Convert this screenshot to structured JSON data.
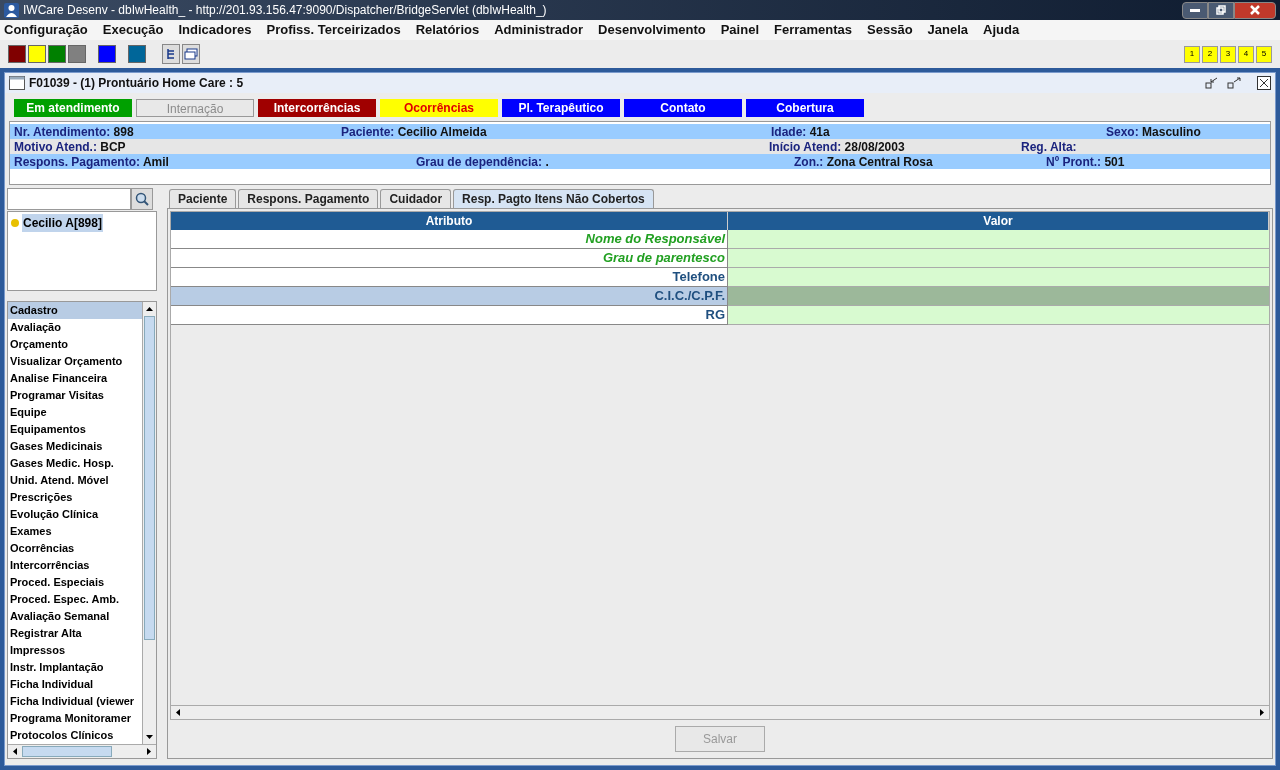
{
  "window": {
    "title": "IWCare Desenv - dbIwHealth_ - http://201.93.156.47:9090/Dispatcher/BridgeServlet (dbIwHealth_)"
  },
  "menu": [
    "Configuração",
    "Execução",
    "Indicadores",
    "Profiss. Terceirizados",
    "Relatórios",
    "Administrador",
    "Desenvolvimento",
    "Painel",
    "Ferramentas",
    "Sessão",
    "Janela",
    "Ajuda"
  ],
  "toolbar": {
    "swatches": [
      {
        "color": "#800000"
      },
      {
        "color": "#ffff00"
      },
      {
        "color": "#008000"
      },
      {
        "color": "#808080"
      },
      {
        "color": "#0000ff"
      },
      {
        "color": "#006699"
      }
    ],
    "pages": [
      "1",
      "2",
      "3",
      "4",
      "5"
    ]
  },
  "frame": {
    "title": "F01039 - (1) Prontuário Home Care : 5",
    "status_buttons": [
      {
        "label": "Em atendimento",
        "color": "#00a000",
        "kind": "normal",
        "disabled": false
      },
      {
        "label": "Internação",
        "color": "#e8e8e8",
        "kind": "normal",
        "disabled": true
      },
      {
        "label": "Intercorrências",
        "color": "#a00000",
        "kind": "normal",
        "disabled": false
      },
      {
        "label": "Ocorrências",
        "color": "#ffff00",
        "kind": "warning",
        "disabled": false
      },
      {
        "label": "Pl. Terapêutico",
        "color": "#0000ff",
        "kind": "normal",
        "disabled": false
      },
      {
        "label": "Contato",
        "color": "#0000ff",
        "kind": "normal",
        "disabled": false
      },
      {
        "label": "Cobertura",
        "color": "#0000ff",
        "kind": "normal",
        "disabled": false
      }
    ],
    "info_rows": [
      [
        {
          "label": "Nr. Atendimento:",
          "value": "898"
        },
        {
          "label": "Paciente:",
          "value": "Cecilio Almeida"
        },
        {
          "label": "Idade:",
          "value": "41a"
        },
        {
          "label": "Sexo:",
          "value": "Masculino"
        }
      ],
      [
        {
          "label": "Motivo Atend.:",
          "value": "BCP"
        },
        {
          "label": "Início Atend:",
          "value": "28/08/2003"
        },
        {
          "label": "Reg. Alta:"
        }
      ],
      [
        {
          "label": "Respons. Pagamento:",
          "value": "Amil"
        },
        {
          "label": "Grau de dependência:",
          "value": "."
        },
        {
          "label": "Zon.:",
          "value": "Zona Central Rosa"
        },
        {
          "label": "Nº Pront.:",
          "value": "501"
        }
      ]
    ]
  },
  "sidebar": {
    "tree": [
      {
        "label": "Cecilio A[898]",
        "selected": true
      }
    ],
    "items": [
      {
        "label": "Cadastro",
        "selected": true
      },
      {
        "label": "Avaliação",
        "selected": false
      },
      {
        "label": "Orçamento",
        "selected": false
      },
      {
        "label": "Visualizar Orçamento",
        "selected": false
      },
      {
        "label": "Analise Financeira",
        "selected": false
      },
      {
        "label": "Programar Visitas",
        "selected": false
      },
      {
        "label": "Equipe",
        "selected": false
      },
      {
        "label": "Equipamentos",
        "selected": false
      },
      {
        "label": "Gases Medicinais",
        "selected": false
      },
      {
        "label": "Gases Medic. Hosp.",
        "selected": false
      },
      {
        "label": "Unid. Atend. Móvel",
        "selected": false
      },
      {
        "label": "Prescrições",
        "selected": false
      },
      {
        "label": "Evolução Clínica",
        "selected": false
      },
      {
        "label": "Exames",
        "selected": false
      },
      {
        "label": "Ocorrências",
        "selected": false
      },
      {
        "label": "Intercorrências",
        "selected": false
      },
      {
        "label": "Proced. Especiais",
        "selected": false
      },
      {
        "label": "Proced. Espec. Amb.",
        "selected": false
      },
      {
        "label": "Avaliação Semanal",
        "selected": false
      },
      {
        "label": "Registrar Alta",
        "selected": false
      },
      {
        "label": "Impressos",
        "selected": false
      },
      {
        "label": "Instr. Implantação",
        "selected": false
      },
      {
        "label": "Ficha Individual",
        "selected": false
      },
      {
        "label": "Ficha Individual (viewer",
        "selected": false
      },
      {
        "label": "Programa Monitoramer",
        "selected": false
      },
      {
        "label": "Protocolos Clínicos",
        "selected": false
      }
    ]
  },
  "tabs": [
    {
      "label": "Paciente",
      "selected": false
    },
    {
      "label": "Respons. Pagamento",
      "selected": false
    },
    {
      "label": "Cuidador",
      "selected": false
    },
    {
      "label": "Resp. Pagto Itens Não Cobertos",
      "selected": true
    }
  ],
  "table": {
    "columns": [
      "Atributo",
      "Valor"
    ],
    "rows": [
      {
        "attribute": "Nome do Responsável",
        "kind": "required",
        "selected": false
      },
      {
        "attribute": "Grau de parentesco",
        "kind": "required",
        "selected": false
      },
      {
        "attribute": "Telefone",
        "kind": "normal",
        "selected": false
      },
      {
        "attribute": "C.I.C./C.P.F.",
        "kind": "normal",
        "selected": true
      },
      {
        "attribute": "RG",
        "kind": "normal",
        "selected": false
      }
    ]
  },
  "save_button": {
    "label": "Salvar",
    "disabled": true
  }
}
